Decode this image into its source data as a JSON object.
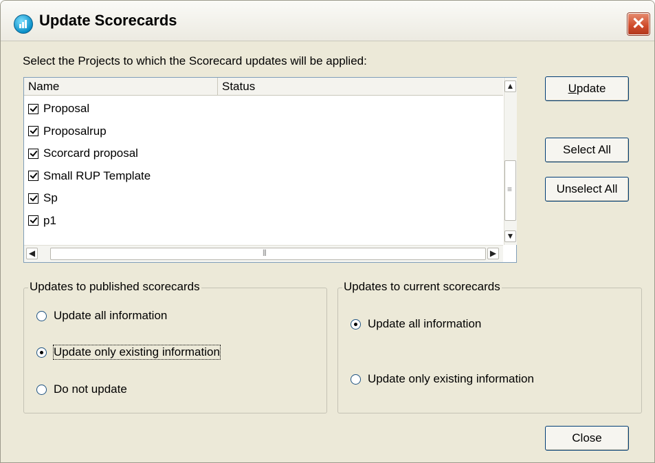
{
  "window": {
    "title": "Update Scorecards",
    "close_glyph": "✕"
  },
  "prompt": "Select the Projects to which the Scorecard updates will be applied:",
  "list": {
    "columns": [
      "Name",
      "Status"
    ],
    "rows": [
      {
        "name": "Proposal",
        "checked": true
      },
      {
        "name": "Proposalrup",
        "checked": true
      },
      {
        "name": "Scorcard proposal",
        "checked": true
      },
      {
        "name": "Small RUP Template",
        "checked": true
      },
      {
        "name": "Sp",
        "checked": true
      },
      {
        "name": "p1",
        "checked": true
      }
    ],
    "scroll_glyphs": {
      "up": "▲",
      "down": "▼",
      "left": "◀",
      "right": "▶"
    }
  },
  "buttons": {
    "update_mnemonic": "U",
    "update_rest": "pdate",
    "select_all": "Select All",
    "unselect_all": "Unselect All",
    "close": "Close"
  },
  "published_group": {
    "title": "Updates to published scorecards",
    "options": [
      {
        "label": "Update all information",
        "selected": false
      },
      {
        "label": "Update only existing information",
        "selected": true
      },
      {
        "label": "Do not update",
        "selected": false
      }
    ]
  },
  "current_group": {
    "title": "Updates to current scorecards",
    "options": [
      {
        "label": "Update all information",
        "selected": true
      },
      {
        "label": "Update only existing information",
        "selected": false
      }
    ]
  },
  "colors": {
    "dialog_bg": "#ece9d8",
    "close_red": "#cf4a2a",
    "list_border": "#7f9db9"
  },
  "icons": [
    "scorecard-app-icon",
    "close-icon",
    "checkbox-checked-icon",
    "scroll-up-icon",
    "scroll-down-icon",
    "scroll-left-icon",
    "scroll-right-icon",
    "radio-icon"
  ]
}
